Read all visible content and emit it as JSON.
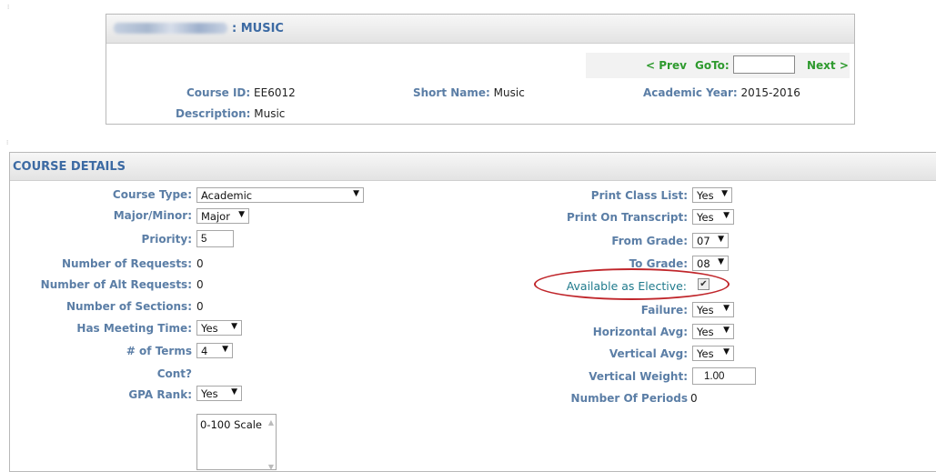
{
  "header": {
    "title": ": MUSIC"
  },
  "nav": {
    "prev_label": "< Prev",
    "goto_label": "GoTo:",
    "goto_value": "",
    "next_label": "Next >"
  },
  "course_info": {
    "course_id_label": "Course ID:",
    "course_id_value": "EE6012",
    "short_name_label": "Short Name:",
    "short_name_value": "Music",
    "academic_year_label": "Academic Year:",
    "academic_year_value": "2015-2016",
    "description_label": "Description:",
    "description_value": "Music"
  },
  "details": {
    "title": "COURSE DETAILS",
    "left": {
      "course_type_label": "Course Type:",
      "course_type_value": "Academic",
      "major_minor_label": "Major/Minor:",
      "major_minor_value": "Major",
      "priority_label": "Priority:",
      "priority_value": "5",
      "num_requests_label": "Number of Requests:",
      "num_requests_value": "0",
      "num_alt_requests_label": "Number of Alt Requests:",
      "num_alt_requests_value": "0",
      "num_sections_label": "Number of Sections:",
      "num_sections_value": "0",
      "has_meeting_time_label": "Has Meeting Time:",
      "has_meeting_time_value": "Yes",
      "num_terms_label": "# of Terms",
      "num_terms_value": "4",
      "cont_label": "Cont?",
      "gpa_rank_label": "GPA Rank:",
      "gpa_rank_value": "Yes",
      "scale_option": "0-100 Scale"
    },
    "right": {
      "print_class_list_label": "Print Class List:",
      "print_class_list_value": "Yes",
      "print_on_transcript_label": "Print On Transcript:",
      "print_on_transcript_value": "Yes",
      "from_grade_label": "From Grade:",
      "from_grade_value": "07",
      "to_grade_label": "To Grade:",
      "to_grade_value": "08",
      "elective_label": "Available as Elective:",
      "failure_label": "Failure:",
      "failure_value": "Yes",
      "horizontal_avg_label": "Horizontal Avg:",
      "horizontal_avg_value": "Yes",
      "vertical_avg_label": "Vertical Avg:",
      "vertical_avg_value": "Yes",
      "vertical_weight_label": "Vertical Weight:",
      "vertical_weight_value": "1.00",
      "num_periods_label": "Number Of Periods",
      "num_periods_value": "0"
    }
  },
  "colors": {
    "label": "#5b7ea6",
    "nav_green": "#2e9a2e",
    "highlight": "#c0262b"
  }
}
